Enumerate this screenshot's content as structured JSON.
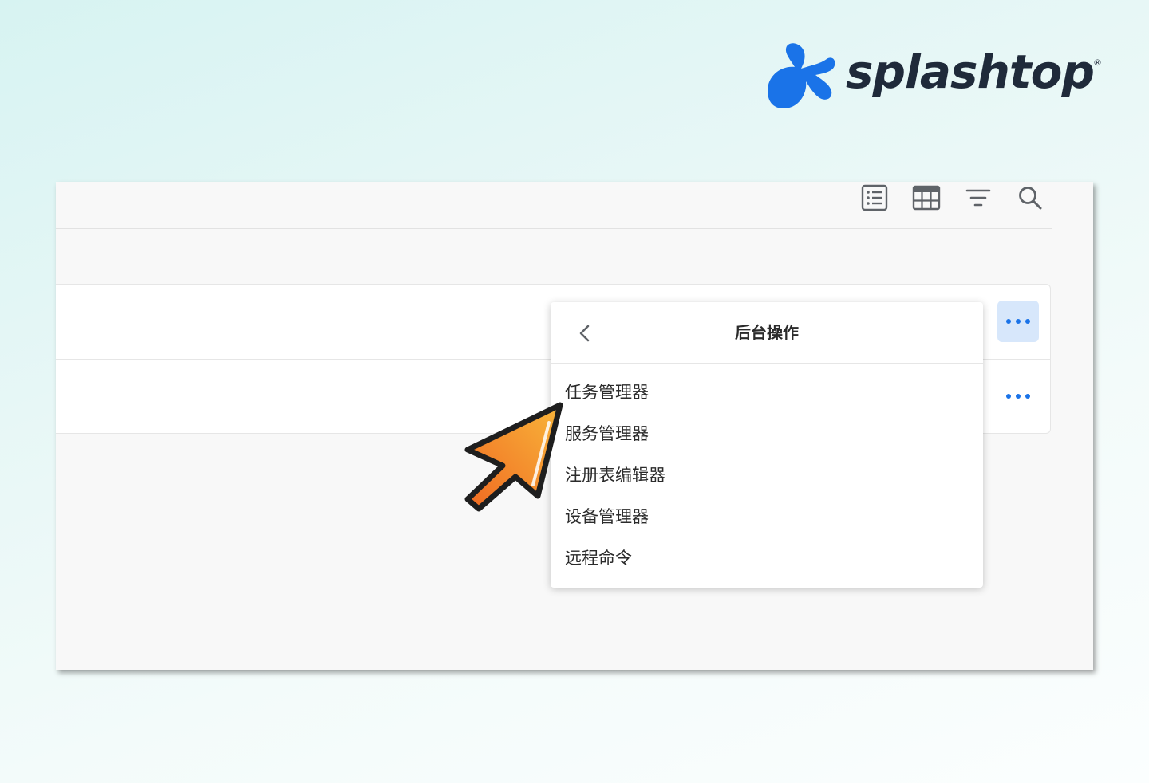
{
  "brand": {
    "name": "splashtop",
    "registered_mark": "®",
    "color_mark": "#1a73e8",
    "color_text": "#1f2a3a"
  },
  "toolbar": {
    "icons": [
      "list-view-icon",
      "grid-view-icon",
      "filter-icon",
      "search-icon"
    ]
  },
  "rows": [
    {
      "more_icon": "more-dots-icon",
      "active": true
    },
    {
      "more_icon": "more-dots-icon",
      "active": false
    }
  ],
  "menu": {
    "title": "后台操作",
    "back_icon": "chevron-left-icon",
    "items": [
      {
        "label": "任务管理器"
      },
      {
        "label": "服务管理器"
      },
      {
        "label": "注册表编辑器"
      },
      {
        "label": "设备管理器"
      },
      {
        "label": "远程命令"
      }
    ]
  },
  "cursor": {
    "icon": "pointer-arrow-icon",
    "color_start": "#f39c2a",
    "color_end": "#f06a22"
  },
  "colors": {
    "accent": "#1a73e8",
    "active_button_bg": "#d7e7fb"
  }
}
